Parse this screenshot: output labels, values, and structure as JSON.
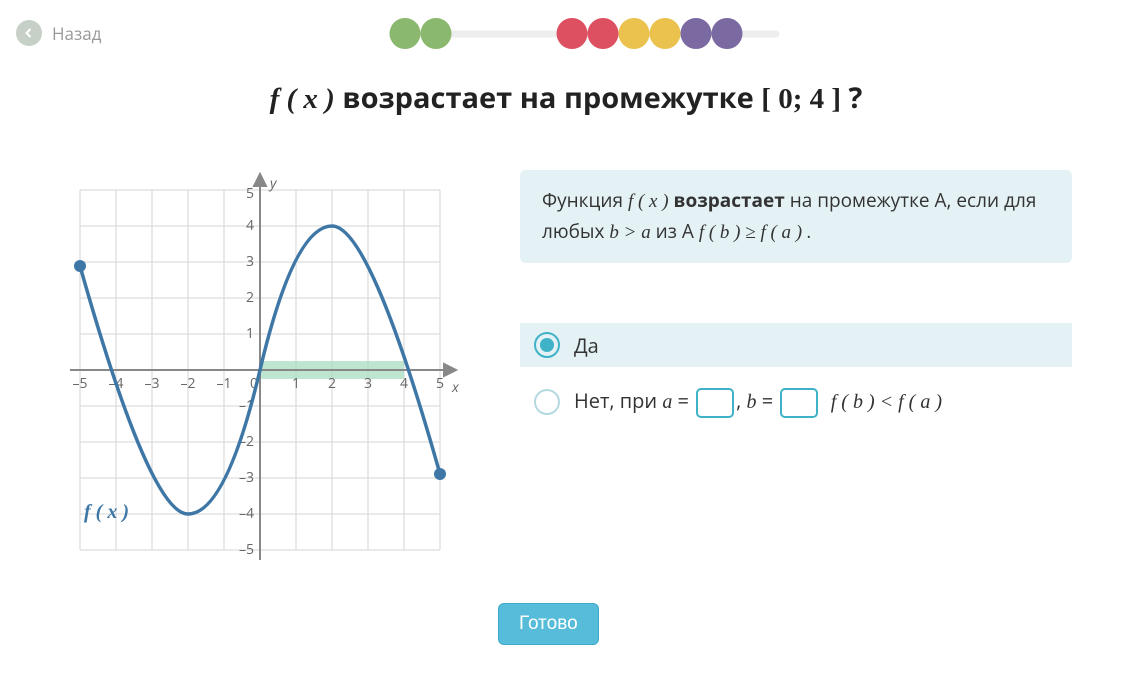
{
  "nav": {
    "back_label": "Назад"
  },
  "progress": {
    "dots": [
      {
        "color": "green"
      },
      {
        "color": "green"
      },
      {
        "gap": true
      },
      {
        "color": "red"
      },
      {
        "color": "red"
      },
      {
        "color": "yellow"
      },
      {
        "color": "yellow"
      },
      {
        "color": "purple"
      },
      {
        "color": "purple"
      }
    ]
  },
  "question": {
    "prefix_math": "f ( x )",
    "text_a": "  возрастает на промежутке  ",
    "interval": "[ 0; 4 ]",
    "text_b": " ?"
  },
  "hint": {
    "line1_a": "Функция ",
    "line1_math": "f ( x )",
    "line1_b": "  возрастает ",
    "line1_c": "на промежутке A, если для любых  ",
    "line1_math2": "b > a",
    "line1_d": "  из A ",
    "line1_math3": "f ( b ) ≥ f ( a ) ."
  },
  "answers": {
    "yes": "Да",
    "no_prefix": "Нет, при ",
    "no_a": "a",
    "no_eq": " = ",
    "no_sep": ",  ",
    "no_b": "b",
    "no_tail": "f ( b ) < f ( a )"
  },
  "submit": {
    "label": "Готово"
  },
  "graph": {
    "fx_label": "f ( x )",
    "x_label": "x",
    "y_label": "y",
    "x_ticks": [
      "–5",
      "–4",
      "–3",
      "–2",
      "–1",
      "0",
      "1",
      "2",
      "3",
      "4",
      "5"
    ],
    "y_ticks": [
      "–5",
      "–4",
      "–3",
      "–2",
      "–1",
      "1",
      "2",
      "3",
      "4",
      "5"
    ],
    "highlight_range": [
      0,
      4
    ]
  },
  "chart_data": {
    "type": "line",
    "xlabel": "x",
    "ylabel": "y",
    "xlim": [
      -5,
      5
    ],
    "ylim": [
      -5,
      5
    ],
    "series": [
      {
        "name": "f(x)",
        "x": [
          -5,
          -4,
          -3,
          -2,
          -1,
          0,
          1,
          2,
          3,
          4,
          5
        ],
        "y": [
          2.9,
          0,
          -3,
          -4,
          -3,
          0,
          3,
          4,
          3,
          0,
          -2.9
        ]
      }
    ],
    "endpoints": [
      {
        "x": -5,
        "y": 2.9
      },
      {
        "x": 5,
        "y": -2.9
      }
    ],
    "highlight_x_interval": [
      0,
      4
    ]
  }
}
